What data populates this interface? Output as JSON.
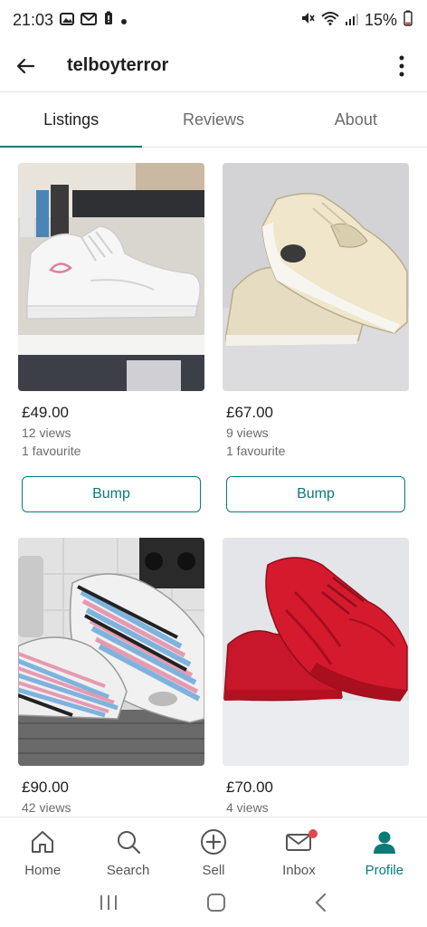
{
  "status": {
    "time": "21:03",
    "battery": "15%"
  },
  "header": {
    "title": "telboyterror"
  },
  "tabs": [
    {
      "label": "Listings",
      "active": true
    },
    {
      "label": "Reviews",
      "active": false
    },
    {
      "label": "About",
      "active": false
    }
  ],
  "listings": [
    {
      "price": "£49.00",
      "views": "12 views",
      "favourites": "1 favourite",
      "bump_label": "Bump",
      "image": "white-high-top-sneaker"
    },
    {
      "price": "£67.00",
      "views": "9 views",
      "favourites": "1 favourite",
      "bump_label": "Bump",
      "image": "beige-air-max-sneaker"
    },
    {
      "price": "£90.00",
      "views": "42 views",
      "image": "multicolor-air-max-95-sneakers"
    },
    {
      "price": "£70.00",
      "views": "4 views",
      "image": "red-gel-lyte-sneakers"
    }
  ],
  "nav": [
    {
      "label": "Home",
      "icon": "home-icon"
    },
    {
      "label": "Search",
      "icon": "search-icon"
    },
    {
      "label": "Sell",
      "icon": "plus-circle-icon"
    },
    {
      "label": "Inbox",
      "icon": "mail-icon"
    },
    {
      "label": "Profile",
      "icon": "person-icon"
    }
  ],
  "colors": {
    "accent": "#0b7a7a",
    "notification": "#e04a4a"
  }
}
